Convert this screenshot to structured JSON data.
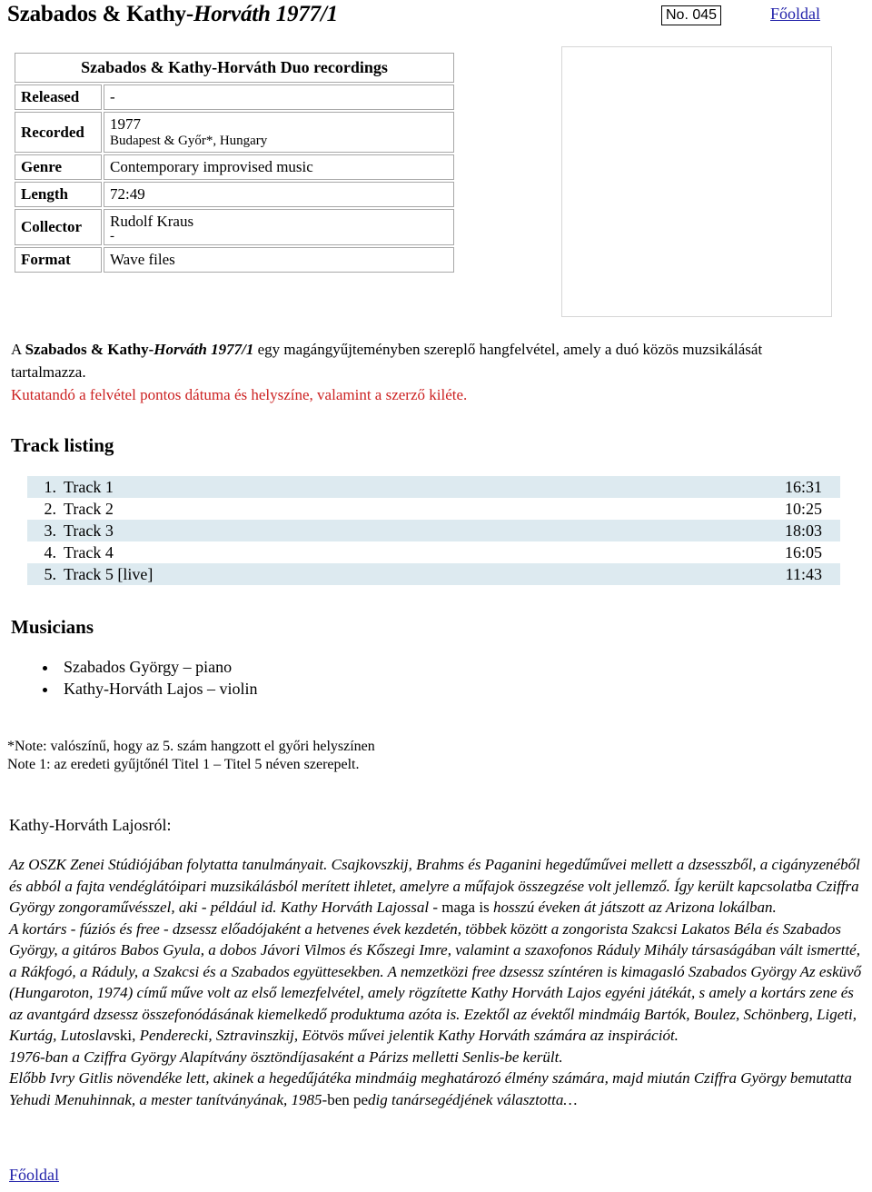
{
  "header": {
    "title_roman": "Szabados & Kathy-",
    "title_italic": "Horváth 1977/1",
    "catalog_number": "No. 045",
    "home_link": "Főoldal"
  },
  "info_table": {
    "caption": "Szabados & Kathy-Horváth Duo recordings",
    "rows": [
      {
        "label": "Released",
        "value": "-",
        "value2": ""
      },
      {
        "label": "Recorded",
        "value": "1977",
        "value2": "Budapest & Győr*, Hungary"
      },
      {
        "label": "Genre",
        "value": "Contemporary improvised music",
        "value2": ""
      },
      {
        "label": "Length",
        "value": "72:49",
        "value2": ""
      },
      {
        "label": "Collector",
        "value": "Rudolf Kraus",
        "value2": "-"
      },
      {
        "label": "Format",
        "value": "Wave files",
        "value2": ""
      }
    ]
  },
  "description": {
    "lead_plain": "A ",
    "lead_bold": "Szabados & Kathy-",
    "lead_bold_italic": "Horváth 1977/1",
    "lead_rest": " egy magángyűjteményben szereplő hangfelvétel, amely a duó közös muzsikálását tartalmazza.",
    "red_note": "Kutatandó a felvétel pontos dátuma és helyszíne, valamint a szerző kiléte."
  },
  "sections": {
    "tracks_heading": "Track listing",
    "musicians_heading": "Musicians"
  },
  "tracks": [
    {
      "num": "1.",
      "title": "Track 1",
      "time": "16:31"
    },
    {
      "num": "2.",
      "title": "Track 2",
      "time": "10:25"
    },
    {
      "num": "3.",
      "title": "Track 3",
      "time": "18:03"
    },
    {
      "num": "4.",
      "title": "Track 4",
      "time": "16:05"
    },
    {
      "num": "5.",
      "title": "Track 5 [live]",
      "time": "11:43"
    }
  ],
  "musicians": [
    "Szabados György – piano",
    "Kathy-Horváth Lajos – violin"
  ],
  "notes": {
    "line1": "*Note:  valószínű, hogy az 5. szám hangzott el győri helyszínen",
    "line2": "Note 1:  az eredeti gyűjtőnél Titel 1 – Titel 5 néven szerepelt."
  },
  "biography": {
    "heading": "Kathy-Horváth Lajosról:",
    "para1_a": "Az OSZK Zenei Stúdiójában folytatta tanulmányait. Csajkovszkij, Brahms és Paganini hegedűművei mellett a dzsesszből, a cigányzenéből és abból a fajta vendéglátóipari muzsikálásból merített ihletet, amelyre a műfajok összegzése volt jellemző. Így került kapcsolatba Cziffra György zongoraművésszel, aki - például id. Kathy Horváth Lajossal - ",
    "para1_upright": "maga is",
    "para1_b": " hosszú éveken át játszott az Arizona lokálban.",
    "para2_a": "A kortárs - fúziós és free - dzsessz előadójaként a hetvenes évek kezdetén, többek között a zongorista Szakcsi Lakatos Béla és Szabados György, a gitáros Babos Gyula, a dobos Jávori Vilmos és Kőszegi Imre, valamint a szaxofonos Ráduly Mihály társaságában vált ismertté, a Rákfogó, a Ráduly, a Szakcsi és a Szabados együttesekben. A nemzetközi free dzsessz színtéren is kimagasló Szabados György Az esküvő (Hungaroton, 1974) című műve volt az első lemezfelvétel, amely rögzítette Kathy Horváth Lajos egyéni játékát, s amely a kortárs zene és az avantgárd dzsessz összefonódásának kiemelkedő produktuma azóta is. Ezektől az évektől mindmáig Bartók, Boulez, Schönberg, Ligeti, Kurtág, Lutoslav",
    "para2_upright": "ski,",
    "para2_b": " Penderecki, Sztravinszkij, Eötvös művei jelentik Kathy Horváth számára az inspirációt.",
    "para3": "1976-ban a Cziffra György Alapítvány ösztöndíjasaként a Párizs melletti Senlis-be került.",
    "para4_a": "Előbb Ivry Gitlis növendéke lett, akinek a hegedűjátéka mindmáig meghatározó élmény számára, majd miután Cziffra György bemutatta Yehudi Menuhinnak, a mester tanítványának, 1985-",
    "para4_upright": "ben pe",
    "para4_b": "dig tanársegédjének választotta…"
  },
  "footer": {
    "home_link": "Főoldal"
  },
  "colors": {
    "link": "#2222aa",
    "red_note": "#cc2222",
    "track_stripe": "#ddeaf0",
    "table_border": "#a8a8a8"
  }
}
